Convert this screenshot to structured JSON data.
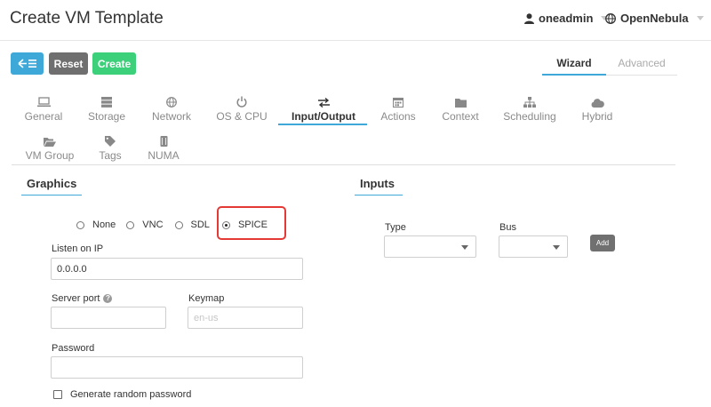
{
  "header": {
    "title": "Create VM Template",
    "user": "oneadmin",
    "zone": "OpenNebula"
  },
  "toolbar": {
    "back_icon": "arrow-left-list-icon",
    "reset_label": "Reset",
    "create_label": "Create",
    "accent_color": "#3ea8d8",
    "create_color": "#3dd07a"
  },
  "mode_tabs": {
    "wizard": "Wizard",
    "advanced": "Advanced",
    "active": "Wizard"
  },
  "tabs": [
    {
      "label": "General",
      "icon": "laptop-icon"
    },
    {
      "label": "Storage",
      "icon": "storage-icon"
    },
    {
      "label": "Network",
      "icon": "globe-icon"
    },
    {
      "label": "OS & CPU",
      "icon": "power-icon"
    },
    {
      "label": "Input/Output",
      "icon": "exchange-icon"
    },
    {
      "label": "Actions",
      "icon": "calendar-icon"
    },
    {
      "label": "Context",
      "icon": "folder-icon"
    },
    {
      "label": "Scheduling",
      "icon": "sitemap-icon"
    },
    {
      "label": "Hybrid",
      "icon": "cloud-icon"
    },
    {
      "label": "VM Group",
      "icon": "folder-open-icon"
    },
    {
      "label": "Tags",
      "icon": "tag-icon"
    },
    {
      "label": "NUMA",
      "icon": "chip-icon"
    }
  ],
  "active_tab": "Input/Output",
  "graphics": {
    "title": "Graphics",
    "options": [
      "None",
      "VNC",
      "SDL",
      "SPICE"
    ],
    "selected": "SPICE",
    "listen_label": "Listen on IP",
    "listen_value": "0.0.0.0",
    "port_label": "Server port",
    "port_value": "",
    "keymap_label": "Keymap",
    "keymap_placeholder": "en-us",
    "password_label": "Password",
    "password_value": "",
    "random_password_label": "Generate random password",
    "random_password_checked": false
  },
  "inputs": {
    "title": "Inputs",
    "type_label": "Type",
    "type_value": "",
    "bus_label": "Bus",
    "bus_value": "",
    "add_label": "Add"
  }
}
